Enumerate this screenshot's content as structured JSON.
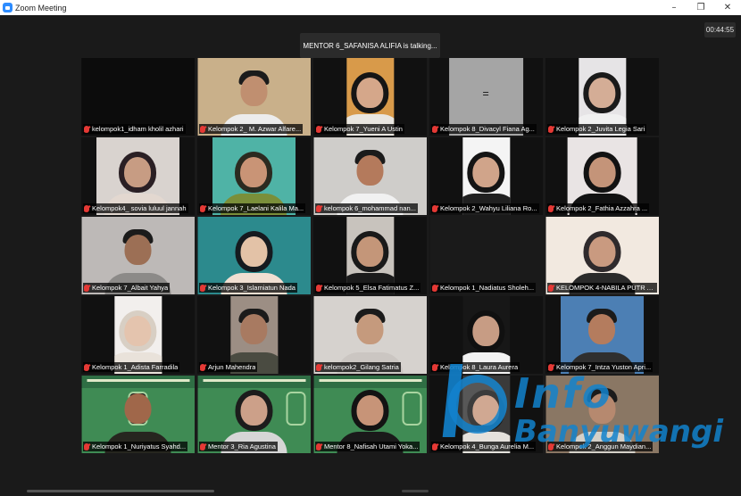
{
  "window": {
    "title": "Zoom Meeting",
    "controls": {
      "minimize": "–",
      "maximize": "❐",
      "close": "✕"
    }
  },
  "meeting": {
    "speaking_banner": "MENTOR 6_SAFANISA ALIFIA is talking...",
    "elapsed": "00:44:55"
  },
  "accent_color": "#2d8cff",
  "muted_icon_color": "#e53935",
  "participants": [
    {
      "name": "kelompok1_idham kholil azhari",
      "muted": true,
      "video": "dark"
    },
    {
      "name": "Kelompok 2_ M. Azwar Alfare...",
      "muted": true,
      "video": "person"
    },
    {
      "name": "Kelompok 7_Yueni A Ustin",
      "muted": true,
      "video": "person"
    },
    {
      "name": "Kelompok 8_Divacyl Fiana Ag...",
      "muted": true,
      "video": "gray"
    },
    {
      "name": "Kelompok 2_Juvita Legia Sari",
      "muted": true,
      "video": "person"
    },
    {
      "name": "Kelompok4_ sovia luluul jannah",
      "muted": true,
      "video": "person"
    },
    {
      "name": "Kelompok 7_Laelani Kalila Ma...",
      "muted": true,
      "video": "person"
    },
    {
      "name": "kelompok 6_mohammad nan...",
      "muted": true,
      "video": "person"
    },
    {
      "name": "Kelompok 2_Wahyu Liliana Ro...",
      "muted": true,
      "video": "person"
    },
    {
      "name": "Kelompok 2_Fathia Azzahra ...",
      "muted": true,
      "video": "person"
    },
    {
      "name": "Kelompok 7_Albait Yahya",
      "muted": true,
      "video": "person"
    },
    {
      "name": "Kelompok 3_Islamiatun Nada",
      "muted": true,
      "video": "person"
    },
    {
      "name": "Kelompok 5_Elsa Fatimatus Z...",
      "muted": true,
      "video": "person"
    },
    {
      "name": "Kelompok 1_Nadiatus Sholeh...",
      "muted": true,
      "video": "dark"
    },
    {
      "name": "KELOMPOK 4-NABILA PUTR A...",
      "muted": true,
      "video": "person"
    },
    {
      "name": "Kelompok 1_Adista Farradila",
      "muted": true,
      "video": "person"
    },
    {
      "name": "Arjun Mahendra",
      "muted": true,
      "video": "person"
    },
    {
      "name": "kelompok2_Gilang Satria",
      "muted": true,
      "video": "person"
    },
    {
      "name": "Kelompok 8_Laura Aurera",
      "muted": true,
      "video": "person"
    },
    {
      "name": "Kelompok 7_Intza Yuston Apri...",
      "muted": true,
      "video": "person"
    },
    {
      "name": "Kelompok 1_Nuriyatus Syahd...",
      "muted": true,
      "video": "green"
    },
    {
      "name": "Mentor 3_Ria Agustina",
      "muted": true,
      "video": "green"
    },
    {
      "name": "Mentor 8_Nafisah Utami Yoka...",
      "muted": true,
      "video": "green"
    },
    {
      "name": "Kelompok 4_Bunga Aurelia M...",
      "muted": true,
      "video": "person"
    },
    {
      "name": "Kelompok 2_Anggun Maydian...",
      "muted": true,
      "video": "person"
    }
  ],
  "watermark": {
    "line1": "Info",
    "line2": "Banyuwangi"
  }
}
